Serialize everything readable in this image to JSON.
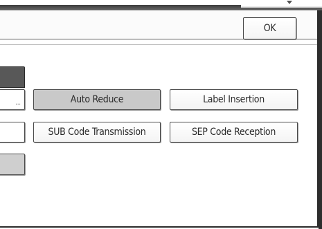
{
  "header": {
    "ok_label": "OK"
  },
  "functions": {
    "auto_reduce": "Auto Reduce",
    "label_insertion": "Label Insertion",
    "sub_code_transmission": "SUB Code Transmission",
    "sep_code_reception": "SEP Code Reception"
  },
  "left_column": {
    "partial_button_ellipsis": "..."
  },
  "icons": {
    "top_arrow": "scroll-down-arrow-icon"
  },
  "colors": {
    "selected_button": "#c9c9c9",
    "frame": "#2b2b2b"
  }
}
